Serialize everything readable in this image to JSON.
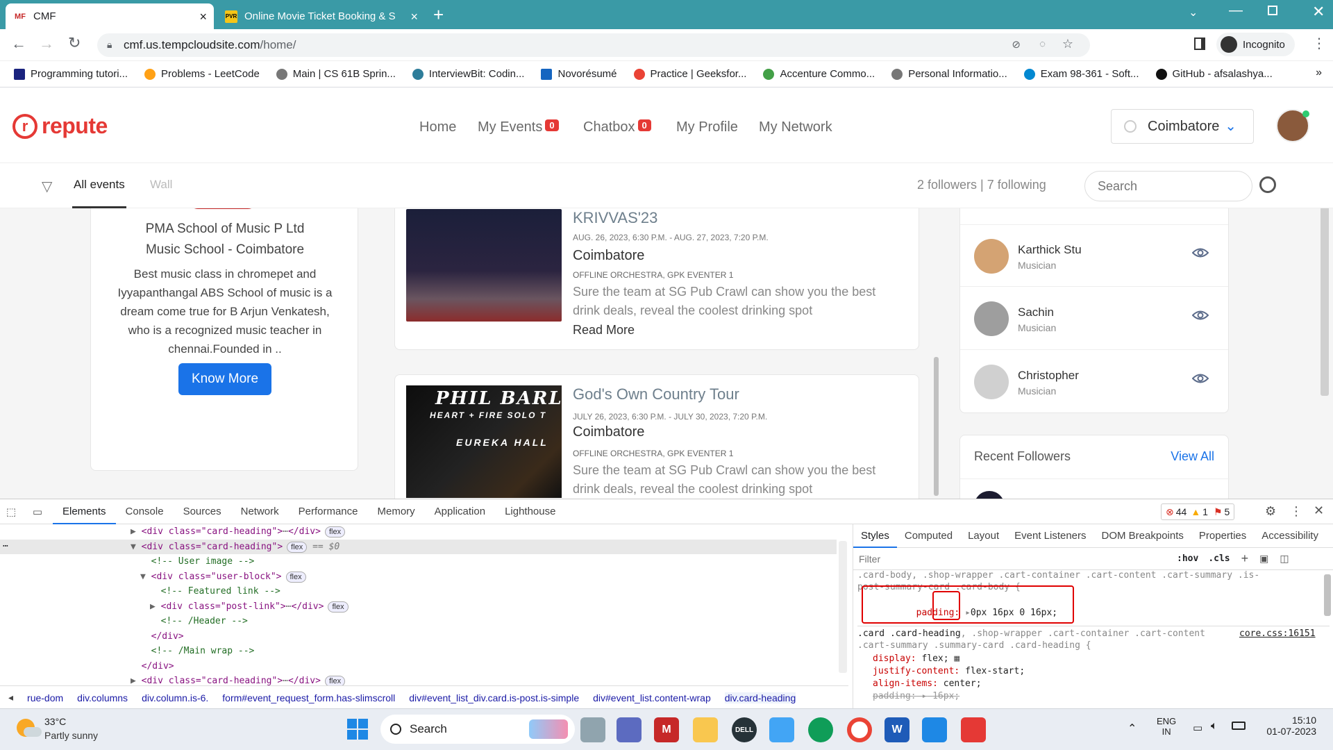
{
  "browser": {
    "tabs": [
      {
        "title": "CMF",
        "favicon": "MF"
      },
      {
        "title": "Online Movie Ticket Booking & S",
        "favicon": "PVR"
      }
    ],
    "url_host": "cmf.us.tempcloudsite.com",
    "url_path": "/home/",
    "profile_label": "Incognito",
    "bookmarks": [
      "Programming tutori...",
      "Problems - LeetCode",
      "Main | CS 61B Sprin...",
      "InterviewBit: Codin...",
      "Novorésumé",
      "Practice | Geeksfor...",
      "Accenture Commo...",
      "Personal Informatio...",
      "Exam 98-361 - Soft...",
      "GitHub - afsalashya..."
    ],
    "bookmarks_more": "»"
  },
  "site": {
    "logo_text": "repute",
    "nav": {
      "home": "Home",
      "events": "My Events",
      "events_badge": "0",
      "chatbox": "Chatbox",
      "chatbox_badge": "0",
      "profile": "My Profile",
      "network": "My Network"
    },
    "city": "Coimbatore",
    "tabs": {
      "all": "All events",
      "wall": "Wall"
    },
    "follow_stats": "2 followers | 7 following",
    "search_placeholder": "Search"
  },
  "left_card": {
    "name": "PMA School of Music P Ltd",
    "subtitle": "Music School - Coimbatore",
    "description": "Best music class in chromepet and Iyyapanthangal ABS School of music is a dream come true for B Arjun Venkatesh, who is a recognized music teacher in chennai.Founded in ..",
    "button": "Know More"
  },
  "events": [
    {
      "title": "KRIVVAS'23",
      "date": "AUG. 26, 2023, 6:30 P.M. - AUG. 27, 2023, 7:20 P.M.",
      "city": "Coimbatore",
      "org": "OFFLINE ORCHESTRA, GPK EVENTER 1",
      "desc": "Sure the team at SG Pub Crawl can show you the best drink deals, reveal the coolest drinking spot",
      "read_more": "Read More"
    },
    {
      "title": "God's Own Country Tour",
      "date": "JULY 26, 2023, 6:30 P.M. - JULY 30, 2023, 7:20 P.M.",
      "city": "Coimbatore",
      "org": "OFFLINE ORCHESTRA, GPK EVENTER 1",
      "desc": "Sure the team at SG Pub Crawl can show you the best drink deals, reveal the coolest drinking spot",
      "poster_line1": "PHIL BARLO",
      "poster_line2": "HEART + FIRE SOLO T",
      "poster_line3": "EUREKA HALL"
    }
  ],
  "followers": [
    {
      "name": "Karthick Stu",
      "role": "Musician"
    },
    {
      "name": "Sachin",
      "role": "Musician"
    },
    {
      "name": "Christopher",
      "role": "Musician"
    }
  ],
  "recent_followers": {
    "title": "Recent Followers",
    "view_all": "View All"
  },
  "devtools": {
    "tabs": [
      "Elements",
      "Console",
      "Sources",
      "Network",
      "Performance",
      "Memory",
      "Application",
      "Lighthouse"
    ],
    "errors": "44",
    "warnings": "1",
    "issues": "5",
    "dom_lines": [
      {
        "indent": 0,
        "arrow": "▶",
        "text": "<div class=\"card-heading\">",
        "tail": "</div>",
        "flex": true
      },
      {
        "indent": 0,
        "arrow": "▼",
        "text": "<div class=\"card-heading\">",
        "tail": "",
        "flex": true,
        "selected": true,
        "eq": "== $0"
      },
      {
        "indent": 1,
        "arrow": "",
        "text": "<!-- User image -->",
        "comment": true
      },
      {
        "indent": 1,
        "arrow": "▼",
        "text": "<div class=\"user-block\">",
        "tail": "",
        "flex": true
      },
      {
        "indent": 2,
        "arrow": "",
        "text": "<!-- Featured link -->",
        "comment": true
      },
      {
        "indent": 2,
        "arrow": "▶",
        "text": "<div class=\"post-link\">",
        "tail": "</div>",
        "flex": true
      },
      {
        "indent": 2,
        "arrow": "",
        "text": "<!-- /Header -->",
        "comment": true
      },
      {
        "indent": 1,
        "arrow": "",
        "text": "</div>"
      },
      {
        "indent": 1,
        "arrow": "",
        "text": "<!-- /Main wrap -->",
        "comment": true
      },
      {
        "indent": 0,
        "arrow": "",
        "text": "</div>"
      },
      {
        "indent": 0,
        "arrow": "▶",
        "text": "<div class=\"card-heading\">",
        "tail": "</div>",
        "flex": true
      }
    ],
    "breadcrumbs": [
      "rue-dom",
      "div.columns",
      "div.column.is-6.",
      "form#event_request_form.has-slimscroll",
      "div#event_list_div.card.is-post.is-simple",
      "div#event_list.content-wrap",
      "div.card-heading"
    ],
    "styles_tabs": [
      "Styles",
      "Computed",
      "Layout",
      "Event Listeners",
      "DOM Breakpoints",
      "Properties",
      "Accessibility"
    ],
    "filter_placeholder": "Filter",
    "hov": ":hov",
    "cls": ".cls",
    "rule1_selector_line1": ".card-body, .shop-wrapper .cart-container .cart-content .cart-summary .is-",
    "rule1_selector_line2": "post-summary-card .card-body {",
    "rule1_prop": "padding:",
    "rule1_val_highlight": "0px",
    "rule1_val_rest": "16px 0 16px;",
    "rule2_selector": ".card .card-heading",
    "rule2_selector_rest": ", .shop-wrapper .cart-container .cart-content",
    "rule2_selector_line2": ".cart-summary .summary-card .card-heading {",
    "rule2_source": "core.css:16151",
    "rule2_props": [
      {
        "p": "display:",
        "v": "flex;"
      },
      {
        "p": "justify-content:",
        "v": "flex-start;"
      },
      {
        "p": "align-items:",
        "v": "center;"
      },
      {
        "p": "padding:",
        "v": "16px;"
      }
    ]
  },
  "taskbar": {
    "temp": "33°C",
    "weather": "Partly sunny",
    "search": "Search",
    "lang1": "ENG",
    "lang2": "IN",
    "time": "15:10",
    "date": "01-07-2023"
  },
  "colors": {
    "chrome_tab_bg": "#3a9aa6",
    "brand_red": "#e53935",
    "primary_button": "#1a73e8",
    "highlight_box": "#e00000"
  }
}
